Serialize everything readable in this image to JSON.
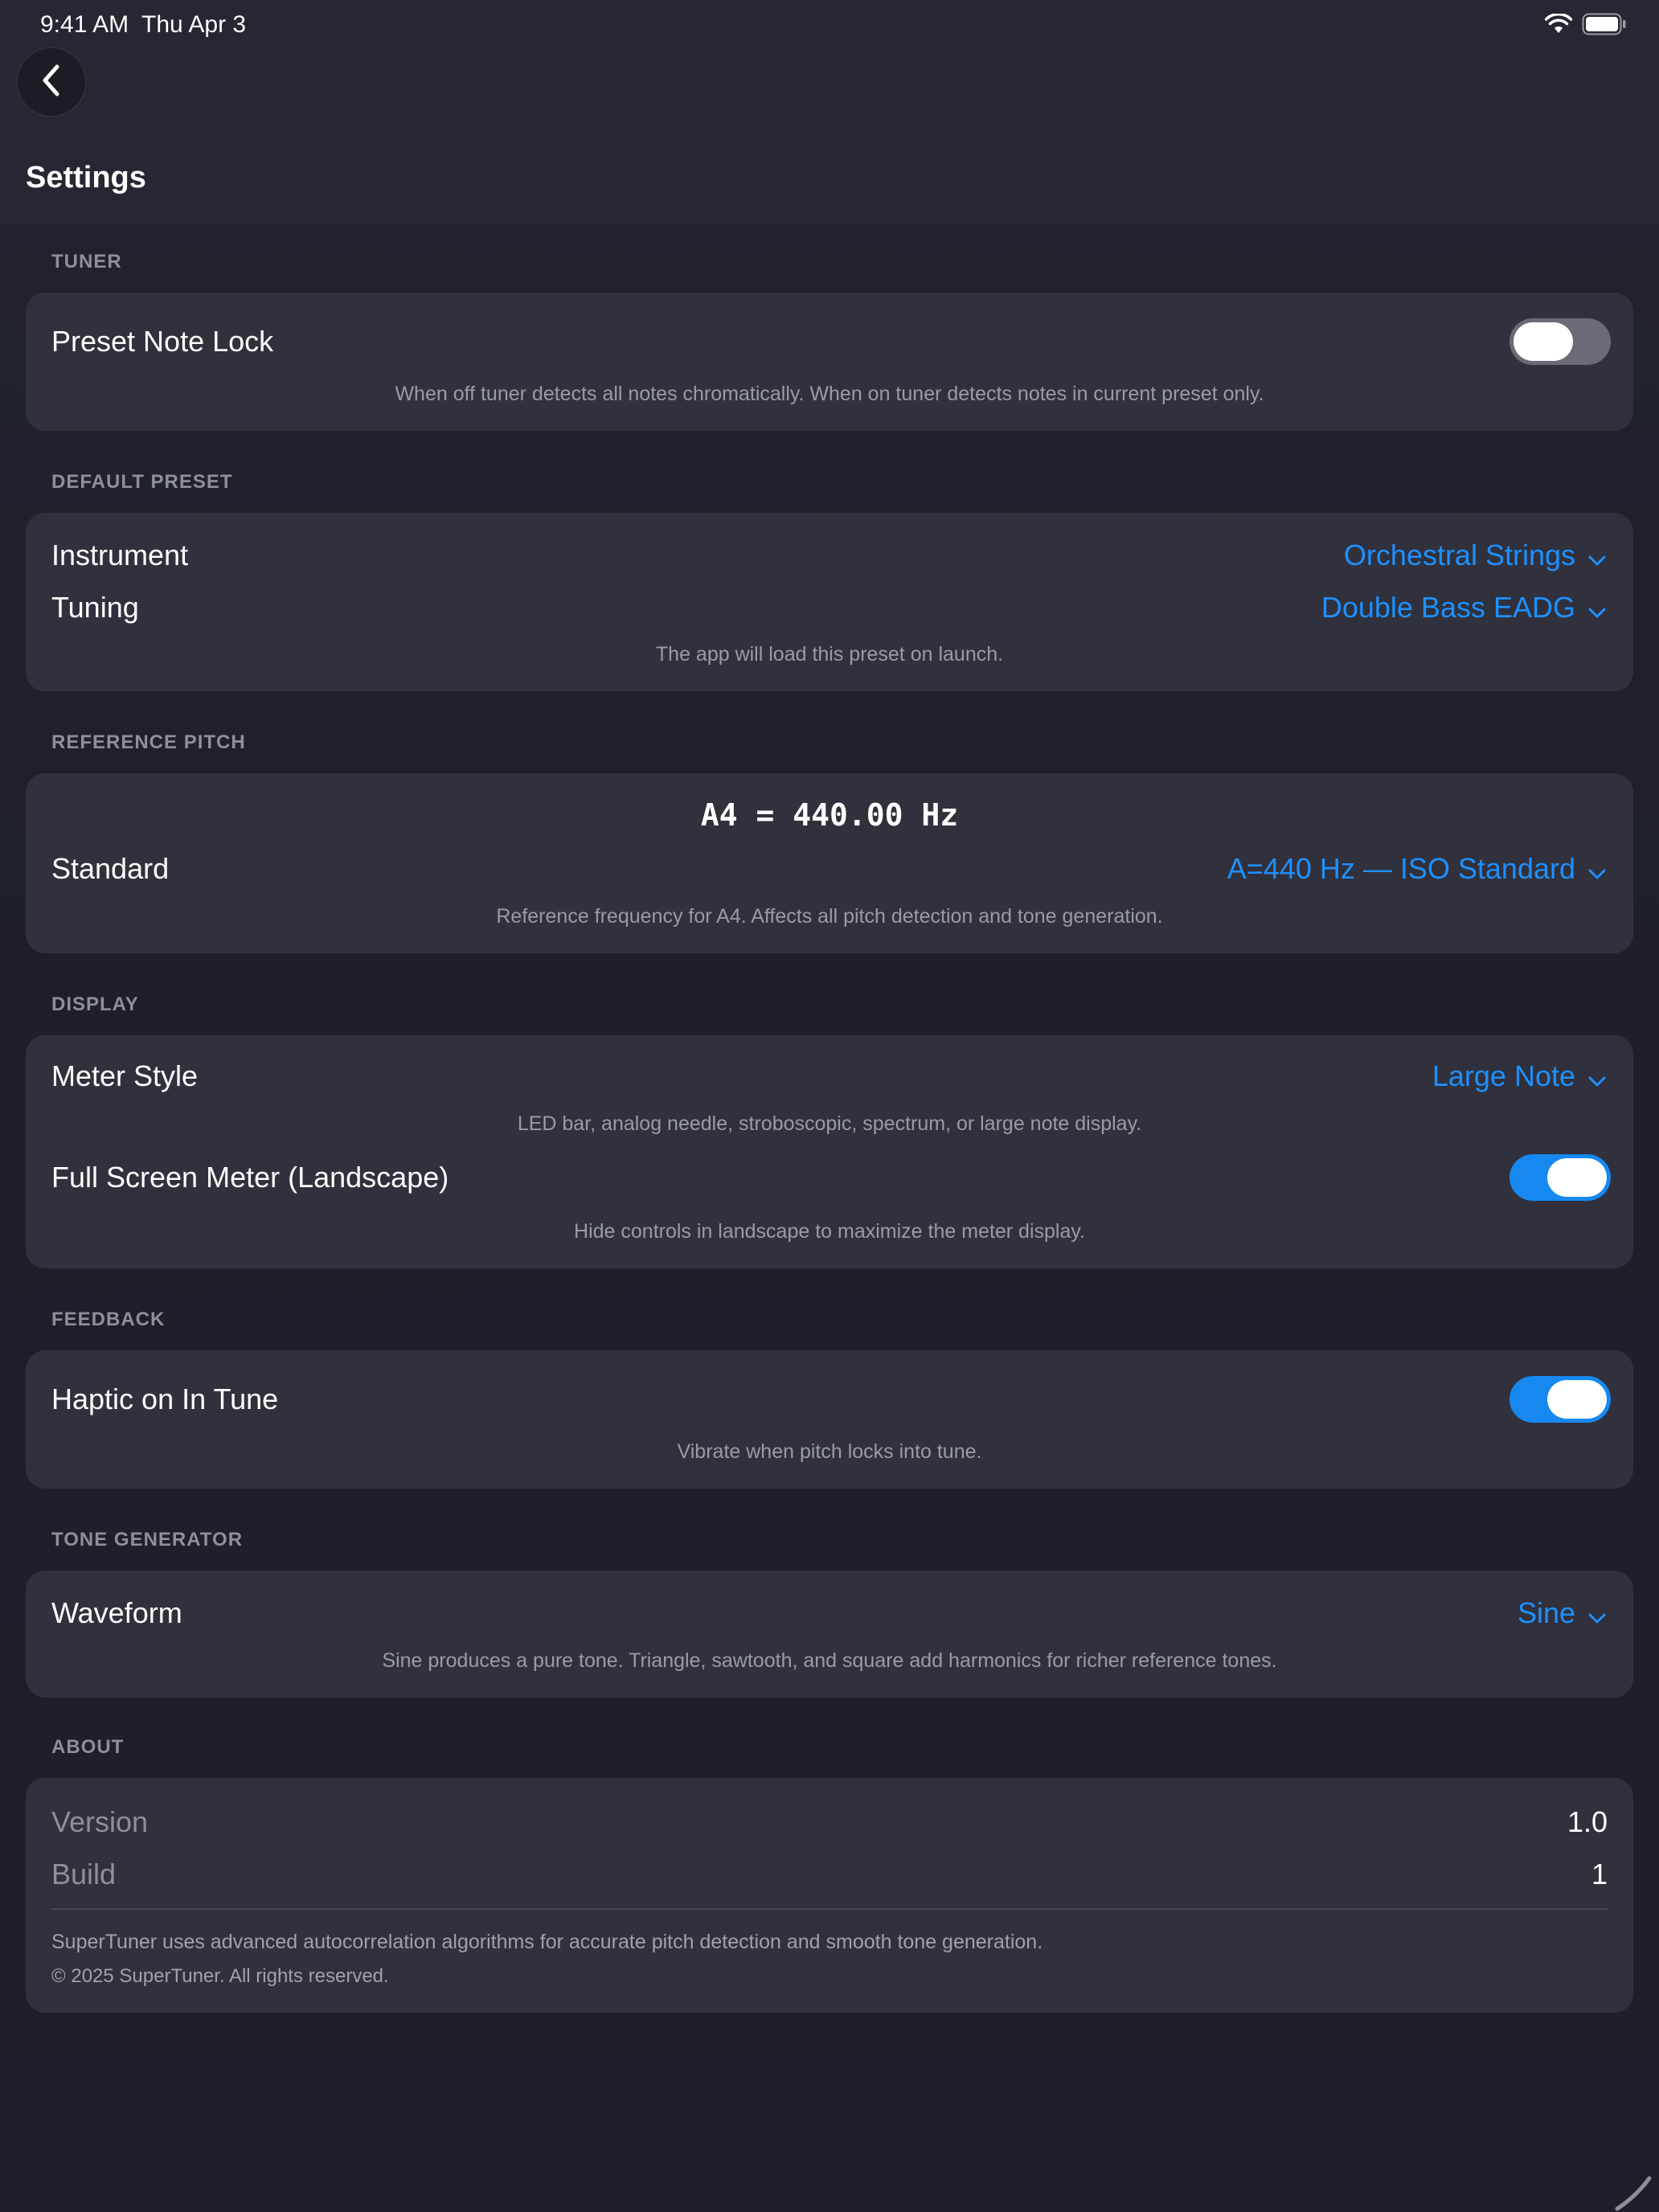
{
  "status_bar": {
    "time": "9:41 AM",
    "date": "Thu Apr 3",
    "icons": [
      "wifi-icon",
      "battery-icon"
    ]
  },
  "nav": {
    "back_icon": "chevron-left-icon",
    "title": "Settings"
  },
  "colors": {
    "accent": "#1e90ff",
    "toggle_on": "#1688f0",
    "toggle_off": "#6a6b76",
    "card": "#30313d",
    "background": "#1f1f2a"
  },
  "sections": {
    "tuner": {
      "header": "TUNER",
      "preset_note_lock": {
        "label": "Preset Note Lock",
        "enabled": false,
        "hint": "When off tuner detects all notes chromatically. When on tuner detects notes in current preset only."
      }
    },
    "default_preset": {
      "header": "DEFAULT PRESET",
      "instrument": {
        "label": "Instrument",
        "value": "Orchestral Strings"
      },
      "tuning": {
        "label": "Tuning",
        "value": "Double Bass EADG"
      },
      "hint": "The app will load this preset on launch."
    },
    "reference_pitch": {
      "header": "REFERENCE PITCH",
      "readout": "A4 = 440.00 Hz",
      "standard": {
        "label": "Standard",
        "value": "A=440 Hz — ISO Standard"
      },
      "hint": "Reference frequency for A4. Affects all pitch detection and tone generation."
    },
    "display": {
      "header": "DISPLAY",
      "meter_style": {
        "label": "Meter Style",
        "value": "Large Note",
        "hint": "LED bar, analog needle, stroboscopic, spectrum, or large note display."
      },
      "full_screen_meter": {
        "label": "Full Screen Meter (Landscape)",
        "enabled": true,
        "hint": "Hide controls in landscape to maximize the meter display."
      }
    },
    "feedback": {
      "header": "FEEDBACK",
      "haptic": {
        "label": "Haptic on In Tune",
        "enabled": true,
        "hint": "Vibrate when pitch locks into tune."
      }
    },
    "tone_generator": {
      "header": "TONE GENERATOR",
      "waveform": {
        "label": "Waveform",
        "value": "Sine",
        "hint": "Sine produces a pure tone. Triangle, sawtooth, and square add harmonics for richer reference tones."
      }
    },
    "about": {
      "header": "ABOUT",
      "version": {
        "label": "Version",
        "value": "1.0"
      },
      "build": {
        "label": "Build",
        "value": "1"
      },
      "description": "SuperTuner uses advanced autocorrelation algorithms for accurate pitch detection and smooth tone generation.",
      "copyright": "© 2025 SuperTuner. All rights reserved."
    }
  }
}
